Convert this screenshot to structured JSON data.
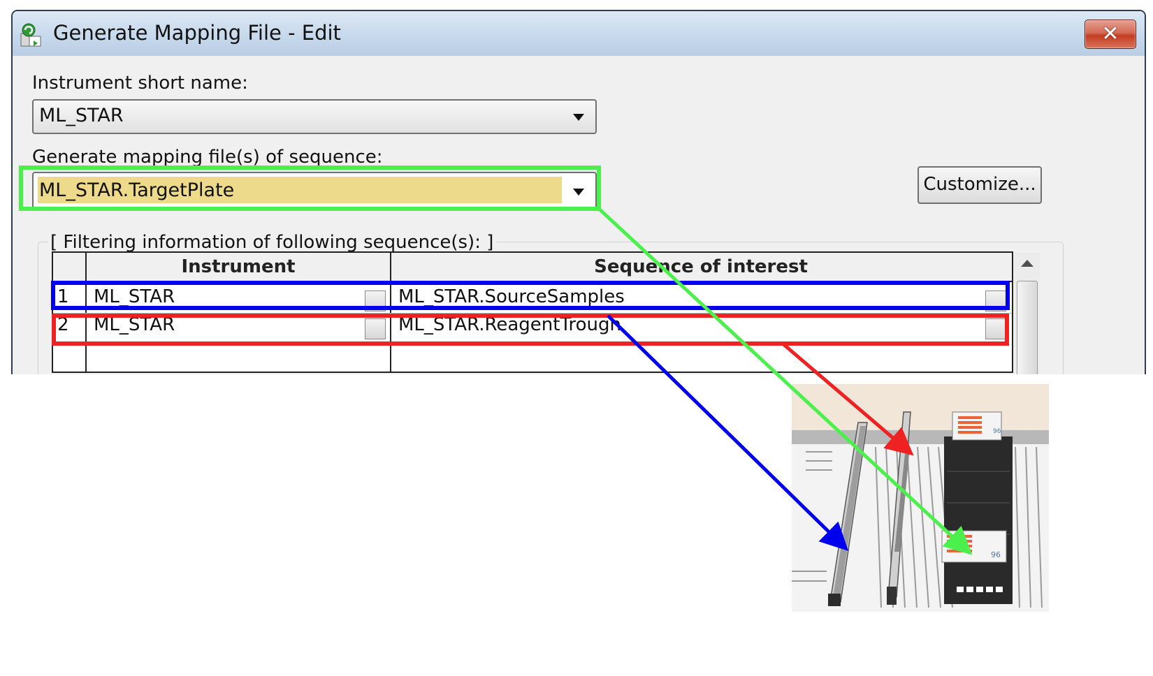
{
  "window": {
    "title": "Generate Mapping File - Edit",
    "close_glyph": "✕"
  },
  "instrument": {
    "label": "Instrument short name:",
    "value": "ML_STAR"
  },
  "sequence": {
    "label": "Generate mapping file(s) of sequence:",
    "value": "ML_STAR.TargetPlate"
  },
  "customize_label": "Customize...",
  "filter": {
    "group_label": "[ Filtering information of following sequence(s): ]",
    "columns": [
      "Instrument",
      "Sequence of interest"
    ],
    "rows": [
      {
        "num": "1",
        "instrument": "ML_STAR",
        "sequence": "ML_STAR.SourceSamples"
      },
      {
        "num": "2",
        "instrument": "ML_STAR",
        "sequence": "ML_STAR.ReagentTrough"
      }
    ]
  },
  "plate_labels": [
    "96",
    "96"
  ],
  "colors": {
    "target_highlight": "#4cf04c",
    "source_highlight": "#0000ee",
    "reagent_highlight": "#ee2222",
    "field_highlight": "#eeda8b"
  },
  "icons": [
    "app-icon",
    "close-icon",
    "dropdown-arrow-icon",
    "scroll-up-icon"
  ]
}
